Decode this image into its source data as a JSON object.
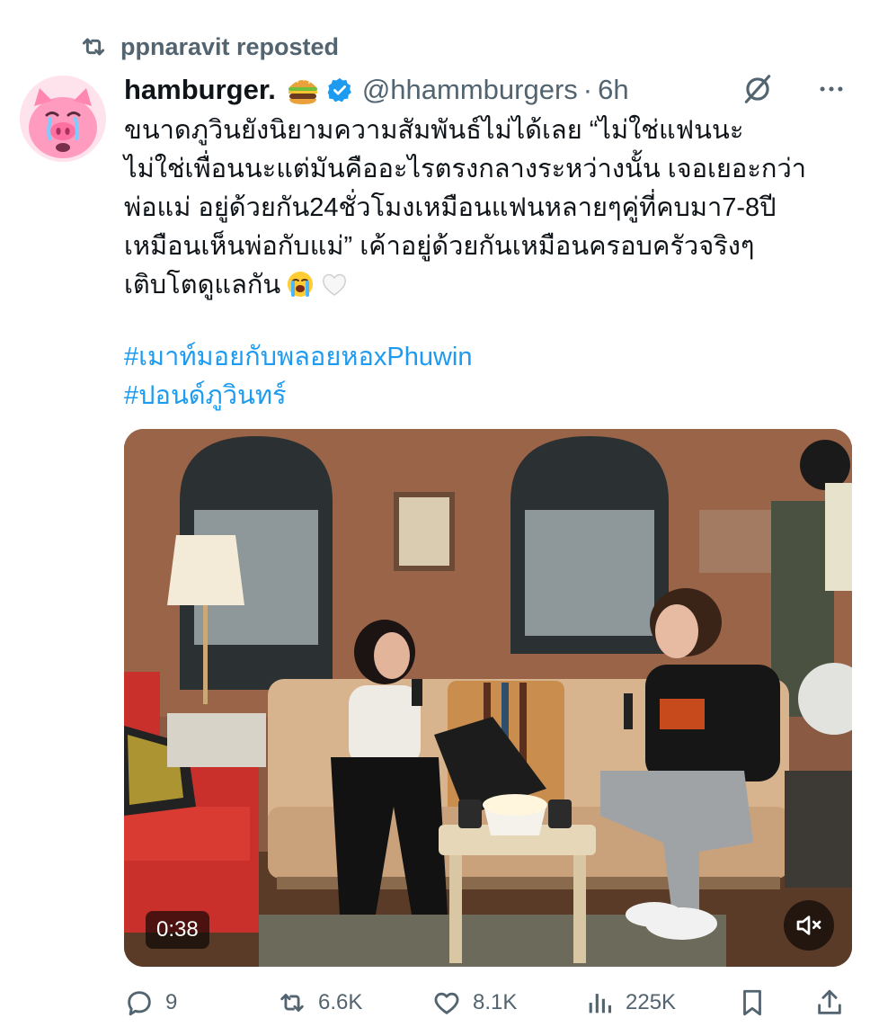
{
  "repost": {
    "text": "ppnaravit reposted",
    "icon": "repost-icon"
  },
  "author": {
    "display_name": "hamburger.",
    "name_emoji": "hamburger-emoji",
    "verified": true,
    "handle": "@hhammburgers",
    "separator": "·",
    "time": "6h",
    "avatar": "pig-avatar"
  },
  "tweet": {
    "lines": [
      "ขนาดภูวินยังนิยามความสัมพันธ์ไม่ได้เลย “ไม่ใช่แฟนนะ",
      "ไม่ใช่เพื่อนนะแต่มันคืออะไรตรงกลางระหว่างนั้น เจอเยอะกว่า",
      "พ่อแม่ อยู่ด้วยกัน24ชั่วโมงเหมือนแฟนหลายๆคู่ที่คบมา7-8ปี",
      "เหมือนเห็นพ่อกับแม่” เค้าอยู่ด้วยกันเหมือนครอบครัวจริงๆ",
      "เติบโตดูแลกัน"
    ],
    "trailing_emojis": [
      "loudly-crying-face-emoji",
      "white-heart-emoji"
    ],
    "hashtags": [
      "#เมาท์มอยกับพลอยหอxPhuwin",
      "#ปอนด์ภูวินทร์"
    ]
  },
  "media": {
    "duration": "0:38",
    "mute_icon": "speaker-muted-icon"
  },
  "actions": {
    "replies": "9",
    "reposts": "6.6K",
    "likes": "8.1K",
    "views": "225K"
  },
  "colors": {
    "accent": "#1d9bf0",
    "secondary_text": "#536471",
    "primary_text": "#0f1419"
  }
}
